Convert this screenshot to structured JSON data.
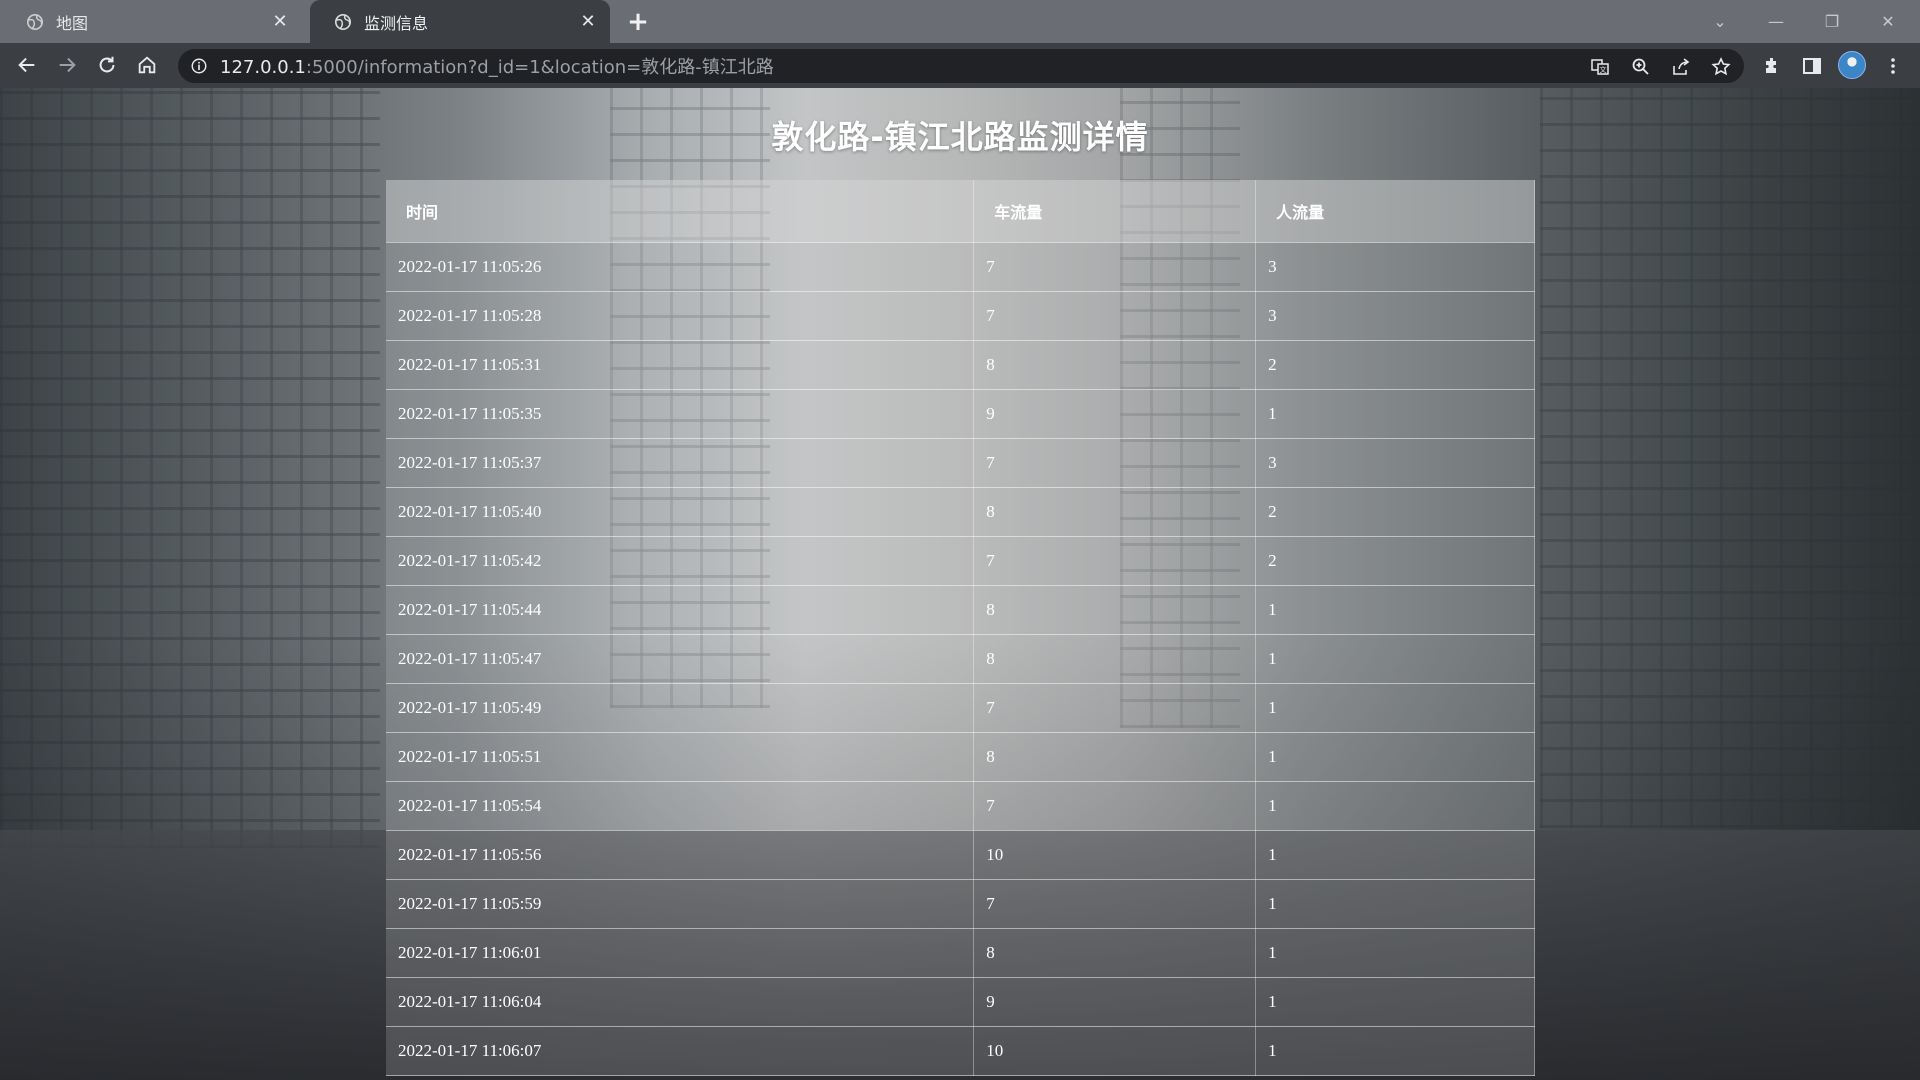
{
  "browser": {
    "tabs": [
      {
        "title": "地图",
        "active": false
      },
      {
        "title": "监测信息",
        "active": true
      }
    ],
    "url": {
      "host": "127.0.0.1",
      "rest": ":5000/information?d_id=1&location=敦化路-镇江北路"
    },
    "accent_color": "#8ab4f8"
  },
  "page": {
    "title": "敦化路-镇江北路监测详情"
  },
  "table": {
    "headers": {
      "time": "时间",
      "cars": "车流量",
      "people": "人流量"
    },
    "rows": [
      {
        "time": "2022-01-17 11:05:26",
        "cars": "7",
        "people": "3"
      },
      {
        "time": "2022-01-17 11:05:28",
        "cars": "7",
        "people": "3"
      },
      {
        "time": "2022-01-17 11:05:31",
        "cars": "8",
        "people": "2"
      },
      {
        "time": "2022-01-17 11:05:35",
        "cars": "9",
        "people": "1"
      },
      {
        "time": "2022-01-17 11:05:37",
        "cars": "7",
        "people": "3"
      },
      {
        "time": "2022-01-17 11:05:40",
        "cars": "8",
        "people": "2"
      },
      {
        "time": "2022-01-17 11:05:42",
        "cars": "7",
        "people": "2"
      },
      {
        "time": "2022-01-17 11:05:44",
        "cars": "8",
        "people": "1"
      },
      {
        "time": "2022-01-17 11:05:47",
        "cars": "8",
        "people": "1"
      },
      {
        "time": "2022-01-17 11:05:49",
        "cars": "7",
        "people": "1"
      },
      {
        "time": "2022-01-17 11:05:51",
        "cars": "8",
        "people": "1"
      },
      {
        "time": "2022-01-17 11:05:54",
        "cars": "7",
        "people": "1"
      },
      {
        "time": "2022-01-17 11:05:56",
        "cars": "10",
        "people": "1"
      },
      {
        "time": "2022-01-17 11:05:59",
        "cars": "7",
        "people": "1"
      },
      {
        "time": "2022-01-17 11:06:01",
        "cars": "8",
        "people": "1"
      },
      {
        "time": "2022-01-17 11:06:04",
        "cars": "9",
        "people": "1"
      },
      {
        "time": "2022-01-17 11:06:07",
        "cars": "10",
        "people": "1"
      }
    ]
  }
}
